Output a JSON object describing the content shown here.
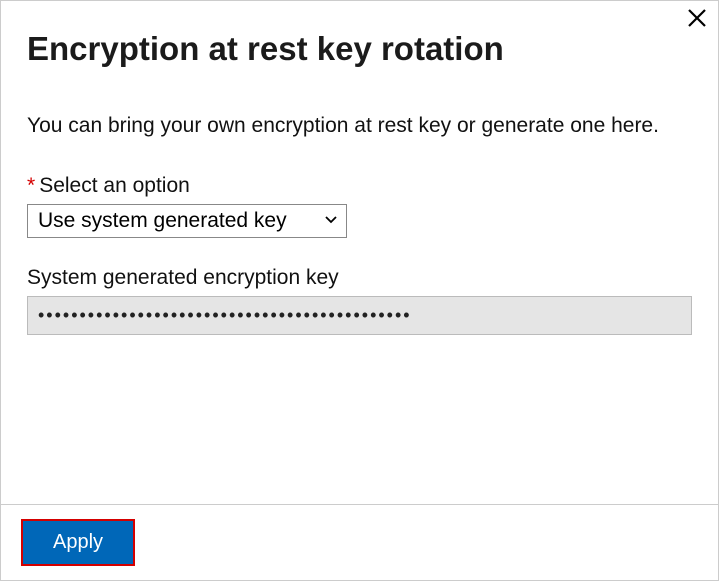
{
  "dialog": {
    "title": "Encryption at rest key rotation",
    "description": "You can bring your own encryption at rest key or generate one here.",
    "option_label": "Select an option",
    "option_selected": "Use system generated key",
    "key_label": "System generated encryption key",
    "key_value": "•••••••••••••••••••••••••••••••••••••••••••••",
    "apply_label": "Apply"
  }
}
